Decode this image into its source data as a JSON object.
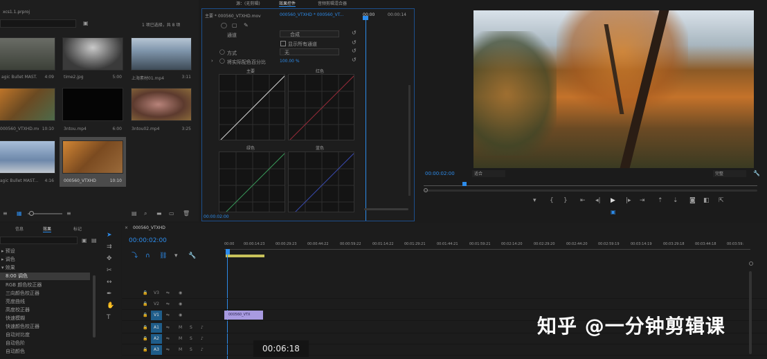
{
  "project": {
    "title": "xcs1.1.prproj",
    "count": "1 项已选择，共 8 项",
    "items": [
      {
        "name": "agic Bullet MAST...",
        "duration": "4:09",
        "color": "#4a4f48"
      },
      {
        "name": "time2.jpg",
        "duration": "5:00",
        "color": "#7c7c7c"
      },
      {
        "name": "上海素材01.mp4",
        "duration": "3:11",
        "color": "#6f8aa3"
      },
      {
        "name": "000560_VTXHD.mov",
        "duration": "10:10",
        "color": "#8b5a2a"
      },
      {
        "name": "3ntou.mp4",
        "duration": "6:00",
        "color": "#050505"
      },
      {
        "name": "3ntou02.mp4",
        "duration": "3:25",
        "color": "#7a5a48"
      },
      {
        "name": "agic Bullet MAST...",
        "duration": "4:16",
        "color": "#7e98b8"
      },
      {
        "name": "000560_VTXHD",
        "duration": "10:10",
        "color": "#8c5a2c"
      }
    ]
  },
  "effects": {
    "tabs": [
      "源：(无剪辑)",
      "效果控件",
      "音频剪辑混合器"
    ],
    "clip_header": "主要 * 000560_VTXHD.mov",
    "sequence_header": "000560_VTXHD * 000560_VT...",
    "time": "00:00",
    "end_time": "00:00:14",
    "channel_label": "通道",
    "channel_value": "合成",
    "show_all": "显示所有通道",
    "mode_label": "方式",
    "mode_value": "无",
    "percent_label": "将实际配色百分比",
    "percent_value": "100.00 %",
    "curve_labels": [
      "主要",
      "红色",
      "绿色",
      "蓝色"
    ],
    "footer_time": "00:00:02:00"
  },
  "program": {
    "timecode": "00:00:02:00",
    "fit": "适合",
    "quality": "完整"
  },
  "lower_left": {
    "tabs": [
      "信息",
      "效果",
      "标记"
    ],
    "items": [
      "预设",
      "调色",
      "效果",
      "8:00 调色",
      "RGB 颜色校正器",
      "三向颜色校正器",
      "亮度曲线",
      "高度校正器",
      "快速模糊",
      "快速颜色校正器",
      "自动对比度",
      "自动色阶",
      "自动颜色"
    ]
  },
  "timeline": {
    "sequence": "000560_VTXHD",
    "timecode": "00:00:02:00",
    "ruler": [
      "00:00",
      "00:00:14:23",
      "00:00:29:23",
      "00:00:44:22",
      "00:00:59:22",
      "00:01:14:22",
      "00:01:29:21",
      "00:01:44:21",
      "00:01:59:21",
      "00:02:14:20",
      "00:02:29:20",
      "00:02:44:20",
      "00:02:59:19",
      "00:03:14:19",
      "00:03:29:18",
      "00:03:44:18",
      "00:03:59:"
    ],
    "tracks": [
      "V3",
      "V2",
      "V1",
      "A1",
      "A2",
      "A3"
    ],
    "clip_label": "000560_VTX",
    "tooltip": "00:06:18"
  },
  "watermark": "知乎 @一分钟剪辑课",
  "colors": {
    "accent": "#2d8ceb",
    "work_area": "#c8c25a",
    "clip": "#a89ae0"
  }
}
